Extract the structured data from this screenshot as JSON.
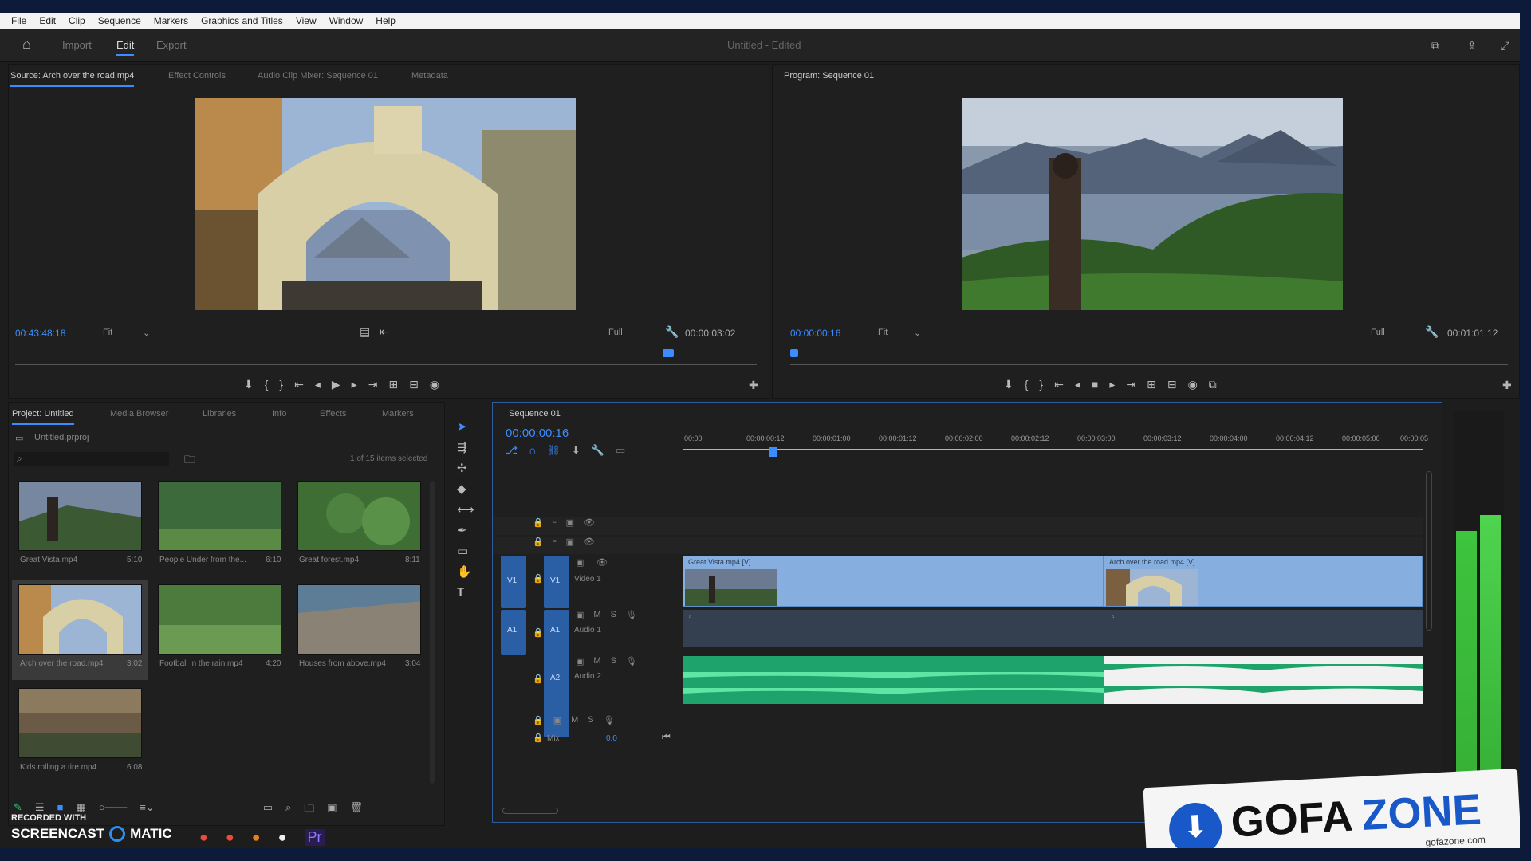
{
  "menu": [
    "File",
    "Edit",
    "Clip",
    "Sequence",
    "Markers",
    "Graphics and Titles",
    "View",
    "Window",
    "Help"
  ],
  "workspaces": {
    "import": "Import",
    "edit": "Edit",
    "export": "Export",
    "title": "Untitled - Edited"
  },
  "source": {
    "tabs": [
      "Source: Arch over the road.mp4",
      "Effect Controls",
      "Audio Clip Mixer: Sequence 01",
      "Metadata"
    ],
    "timecode": "00:43:48:18",
    "fit": "Fit",
    "quality": "Full",
    "duration": "00:00:03:02"
  },
  "program": {
    "tab": "Program: Sequence 01",
    "timecode": "00:00:00:16",
    "fit": "Fit",
    "quality": "Full",
    "duration": "00:01:01:12"
  },
  "project": {
    "tabs": [
      "Project: Untitled",
      "Media Browser",
      "Libraries",
      "Info",
      "Effects",
      "Markers"
    ],
    "file": "Untitled.prproj",
    "selected": "1 of 15 items selected",
    "items": [
      {
        "name": "Great Vista.mp4",
        "dur": "5:10"
      },
      {
        "name": "People Under from the...",
        "dur": "6:10"
      },
      {
        "name": "Great forest.mp4",
        "dur": "8:11"
      },
      {
        "name": "Arch over the road.mp4",
        "dur": "3:02"
      },
      {
        "name": "Football in the rain.mp4",
        "dur": "4:20"
      },
      {
        "name": "Houses from above.mp4",
        "dur": "3:04"
      },
      {
        "name": "Kids rolling a tire.mp4",
        "dur": "6:08"
      }
    ]
  },
  "sequence": {
    "tab": "Sequence 01",
    "timecode": "00:00:00:16",
    "ruler": [
      "00:00",
      "00:00:00:12",
      "00:00:01:00",
      "00:00:01:12",
      "00:00:02:00",
      "00:00:02:12",
      "00:00:03:00",
      "00:00:03:12",
      "00:00:04:00",
      "00:00:04:12",
      "00:00:05:00",
      "00:00:05"
    ],
    "tracks": {
      "v1": "V1",
      "video1": "Video 1",
      "a1": "A1",
      "audio1": "Audio 1",
      "a2": "A2",
      "audio2": "Audio 2",
      "mix": "Mix",
      "mixval": "0.0"
    },
    "clips": [
      "Great Vista.mp4 [V]",
      "Arch over the road.mp4 [V]"
    ]
  },
  "watermark": {
    "recorded": "RECORDED WITH",
    "brand1": "SCREENCAST",
    "brand2": "MATIC",
    "logo1": "GOFA",
    "logo2": "ZONE",
    "site": "gofazone.com"
  }
}
